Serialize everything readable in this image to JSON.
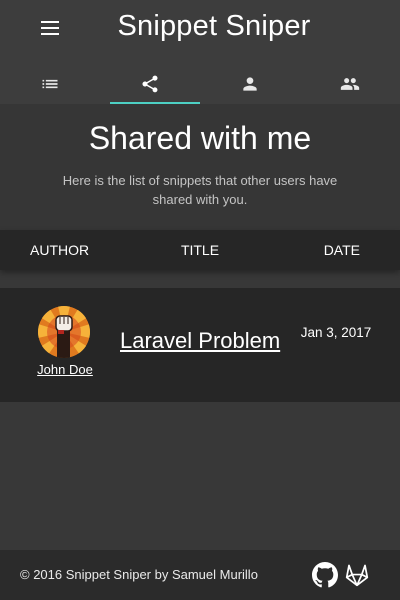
{
  "header": {
    "app_title": "Snippet Sniper",
    "menu_icon": "hamburger-menu-icon",
    "tabs": [
      {
        "icon": "list-icon",
        "active": false
      },
      {
        "icon": "share-icon",
        "active": true
      },
      {
        "icon": "person-icon",
        "active": false
      },
      {
        "icon": "people-icon",
        "active": false
      }
    ],
    "accent_color": "#4dd0c4"
  },
  "hero": {
    "title": "Shared with me",
    "subtitle": "Here is the list of snippets that other users have shared with you."
  },
  "table": {
    "columns": [
      "AUTHOR",
      "TITLE",
      "DATE"
    ],
    "rows": [
      {
        "author": "John Doe",
        "avatar_icon": "raised-fist-avatar-icon",
        "title": "Laravel Problem",
        "date": "Jan 3, 2017"
      }
    ]
  },
  "footer": {
    "copyright": "© 2016 Snippet Sniper by Samuel Murillo",
    "icons": [
      "github-icon",
      "gitlab-icon"
    ]
  }
}
